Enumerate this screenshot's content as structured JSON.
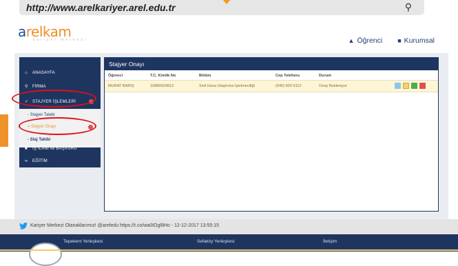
{
  "browser": {
    "url": "http://www.arelkariyer.arel.edu.tr",
    "search_icon": "search-icon"
  },
  "logo": {
    "text_a": "a",
    "text_rest": "relkam",
    "sub": "kariyer merkezi"
  },
  "topnav": {
    "student": "Öğrenci",
    "corporate": "Kurumsal",
    "student_icon": "graduation-cap-icon",
    "corporate_icon": "briefcase-icon"
  },
  "sidebar": {
    "items": [
      {
        "label": "ANASAYFA",
        "icon": "home-icon"
      },
      {
        "label": "FİRMA",
        "icon": "pin-icon"
      },
      {
        "label": "STAJYER İŞLEMLERİ",
        "icon": "tag-icon"
      },
      {
        "label": "İŞ İLANI ve BAŞVURU",
        "icon": "briefcase-icon"
      },
      {
        "label": "EĞİTİM",
        "icon": "link-icon"
      }
    ],
    "sub_items": [
      "- Stajyer Talebi",
      "» Stajyer Onayı",
      "- Staj Takibi"
    ]
  },
  "main": {
    "title": "Stajyer Onayı",
    "columns": [
      "Öğrenci",
      "T.C. Kimlik No",
      "Bölüm",
      "Cep Telefonu",
      "Durum"
    ],
    "rows": [
      {
        "student": "MURAT BARIŞ",
        "tc": "16880929812",
        "department": "Sivil Hava Ulaştırma İşletmeciliği",
        "phone": "(546) 829 9112",
        "status": "Onay Bekleniyor"
      }
    ]
  },
  "colors": {
    "navy": "#1e3560",
    "orange": "#f28c28",
    "highlight": "#e0101a"
  },
  "footer": {
    "tweet": "Kariyer Merkezi Olanaklarımız! @areledu https://t.co/wa0IOgl8Ho - 12-12-2017 13:55:15",
    "col1": "Tepekent Yerleşkesi",
    "col2": "Sefaköy Yerleşkesi",
    "col3": "İletişim"
  }
}
